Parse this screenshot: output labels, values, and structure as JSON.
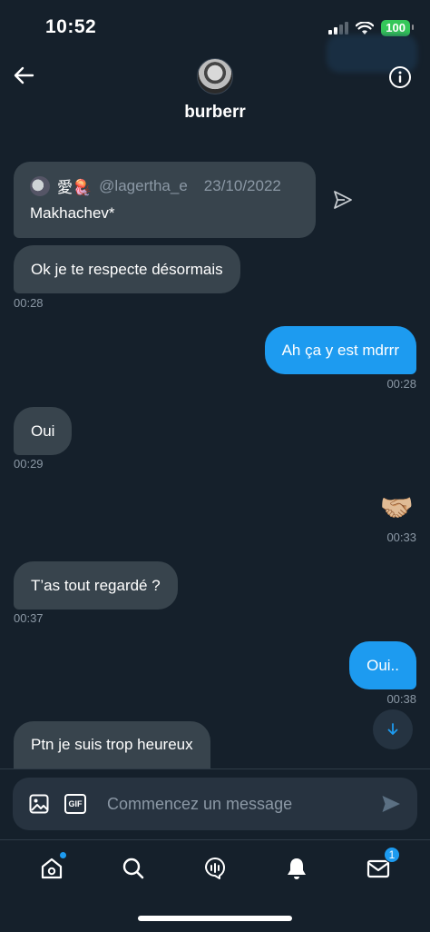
{
  "status_bar": {
    "time": "10:52",
    "battery": "100"
  },
  "header": {
    "name": "burberr"
  },
  "quote": {
    "emoji_name": "愛🪼",
    "handle": "@lagertha_e",
    "date": "23/10/2022",
    "text": "Makhachev*"
  },
  "messages": [
    {
      "text": "Ok je te respecte désormais",
      "time": "00:28"
    },
    {
      "text": "Ah ça y est mdrrr",
      "time": "00:28"
    },
    {
      "text": "Oui",
      "time": "00:29"
    },
    {
      "text": "🤝🏼",
      "time": "00:33"
    },
    {
      "text": "T’as tout regardé ?",
      "time": "00:37"
    },
    {
      "text": "Oui..",
      "time": "00:38"
    },
    {
      "text": "Ptn je suis trop heureux",
      "time": ""
    }
  ],
  "composer": {
    "placeholder": "Commencez un message",
    "gif_label": "GIF"
  },
  "nav": {
    "messages_badge": "1"
  },
  "colors": {
    "background": "#15202b",
    "incoming": "#38444d",
    "outgoing": "#1d9bf0",
    "muted": "#8b98a5"
  }
}
